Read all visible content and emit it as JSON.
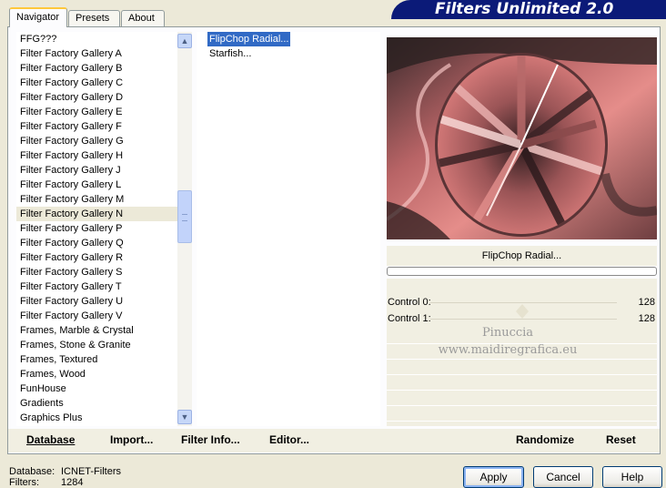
{
  "header": {
    "banner_title": "Filters Unlimited 2.0"
  },
  "tabs": [
    {
      "label": "Navigator",
      "active": true
    },
    {
      "label": "Presets",
      "active": false
    },
    {
      "label": "About",
      "active": false
    }
  ],
  "categories": {
    "items": [
      "FFG???",
      "Filter Factory Gallery A",
      "Filter Factory Gallery B",
      "Filter Factory Gallery C",
      "Filter Factory Gallery D",
      "Filter Factory Gallery E",
      "Filter Factory Gallery F",
      "Filter Factory Gallery G",
      "Filter Factory Gallery H",
      "Filter Factory Gallery J",
      "Filter Factory Gallery L",
      "Filter Factory Gallery M",
      "Filter Factory Gallery N",
      "Filter Factory Gallery P",
      "Filter Factory Gallery Q",
      "Filter Factory Gallery R",
      "Filter Factory Gallery S",
      "Filter Factory Gallery T",
      "Filter Factory Gallery U",
      "Filter Factory Gallery V",
      "Frames, Marble & Crystal",
      "Frames, Stone & Granite",
      "Frames, Textured",
      "Frames, Wood",
      "FunHouse",
      "Gradients",
      "Graphics Plus"
    ],
    "selected": "Filter Factory Gallery N"
  },
  "filters": {
    "items": [
      "FlipChop Radial...",
      "Starfish..."
    ],
    "selected": "FlipChop Radial..."
  },
  "preview": {
    "filter_name": "FlipChop Radial...",
    "progress": 0
  },
  "controls": [
    {
      "label": "Control 0:",
      "value": "128"
    },
    {
      "label": "Control 1:",
      "value": "128"
    }
  ],
  "watermark": {
    "line1": "Pinuccia",
    "line2": "www.maidiregrafica.eu"
  },
  "toolbar": {
    "database": "Database",
    "import": "Import...",
    "filter_info": "Filter Info...",
    "editor": "Editor...",
    "randomize": "Randomize",
    "reset": "Reset"
  },
  "status": {
    "database_label": "Database:",
    "database_value": "ICNET-Filters",
    "filters_label": "Filters:",
    "filters_value": "1284"
  },
  "dialog_buttons": {
    "apply": "Apply",
    "cancel": "Cancel",
    "help": "Help"
  },
  "colors": {
    "selection": "#316ac5",
    "banner": "#0b1a78",
    "dialog_bg": "#ece9d8"
  }
}
